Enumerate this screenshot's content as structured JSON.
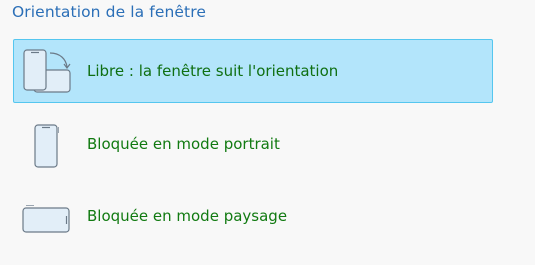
{
  "section": {
    "title": "Orientation de la fenêtre"
  },
  "options": [
    {
      "label": "Libre : la fenêtre suit l'orientation",
      "icon": "rotate-device-icon",
      "selected": true
    },
    {
      "label": "Bloquée en mode portrait",
      "icon": "portrait-lock-icon",
      "selected": false
    },
    {
      "label": "Bloquée en mode paysage",
      "icon": "landscape-lock-icon",
      "selected": false
    }
  ],
  "colors": {
    "title": "#2b6fb7",
    "label": "#117a11",
    "selected_bg": "#b3e5fb",
    "selected_border": "#55c6ef"
  }
}
